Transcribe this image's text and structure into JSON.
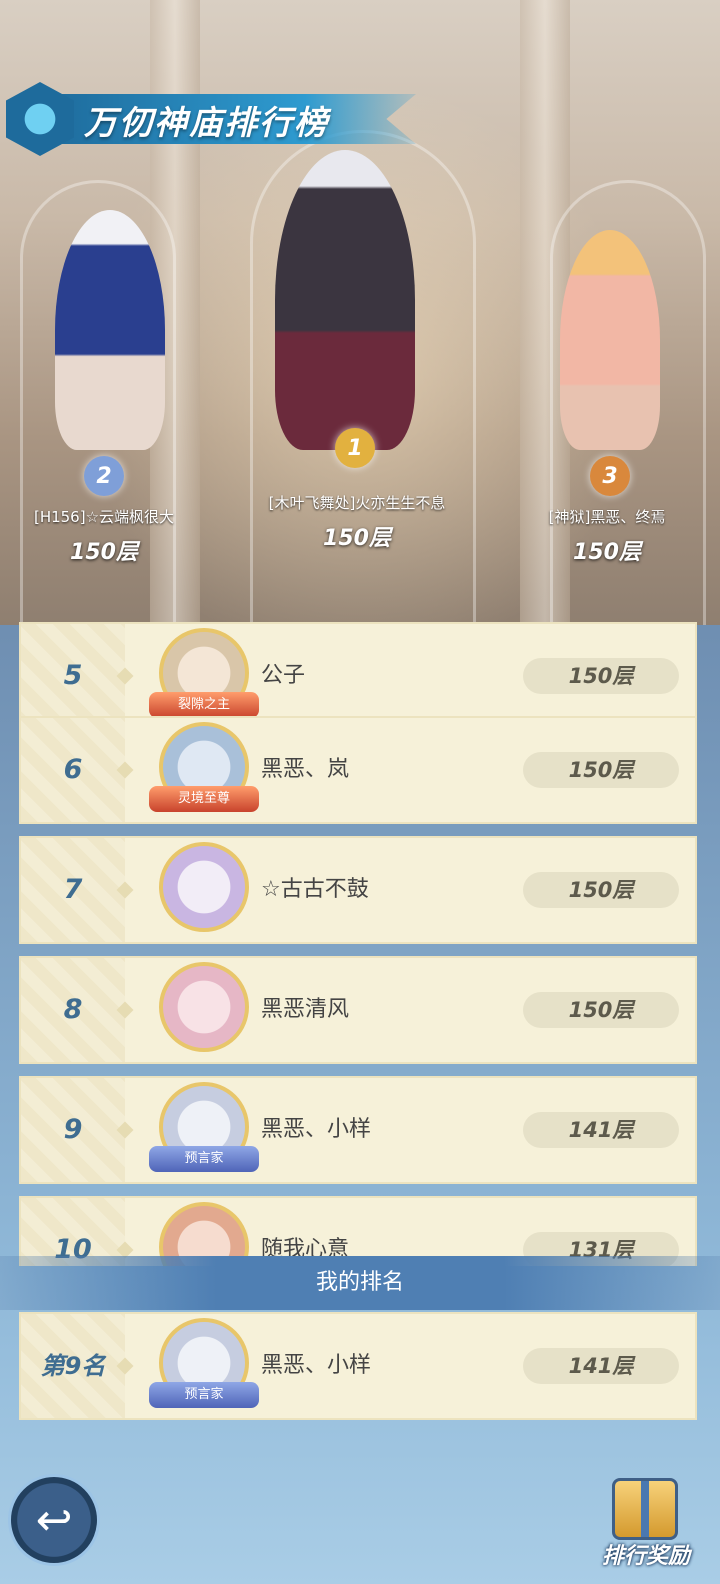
{
  "header": {
    "title": "万仞神庙排行榜"
  },
  "podium": [
    {
      "place": "1",
      "name": "[木叶飞舞处]火亦生生不息",
      "floor": "150层",
      "color": "#e2b13f"
    },
    {
      "place": "2",
      "name": "[H156]☆云端枫很大",
      "floor": "150层",
      "color": "#7f9fd8"
    },
    {
      "place": "3",
      "name": "[神狱]黑恶、终焉",
      "floor": "150层",
      "color": "#d9883c"
    }
  ],
  "rankings": [
    {
      "rank": "5",
      "name": "公子",
      "floor": "150层",
      "badge": "裂隙之主",
      "avatar_color": "#d9c6a9"
    },
    {
      "rank": "6",
      "name": "黑恶、岚",
      "floor": "150层",
      "badge": "灵境至尊",
      "avatar_color": "#a9c0d9"
    },
    {
      "rank": "7",
      "name": "☆古古不鼓",
      "floor": "150层",
      "badge": "",
      "avatar_color": "#c9b6e2"
    },
    {
      "rank": "8",
      "name": "黑恶清风",
      "floor": "150层",
      "badge": "",
      "avatar_color": "#e6b7c6"
    },
    {
      "rank": "9",
      "name": "黑恶、小样",
      "floor": "141层",
      "badge": "预言家",
      "avatar_color": "#c6cde0"
    },
    {
      "rank": "10",
      "name": "随我心意",
      "floor": "131层",
      "badge": "",
      "avatar_color": "#e2a98f"
    }
  ],
  "my_ranking": {
    "section_label": "我的排名",
    "rank": "第9名",
    "name": "黑恶、小样",
    "floor": "141层",
    "badge": "预言家"
  },
  "footer": {
    "back_icon": "back-arrow-icon",
    "reward_label": "排行奖励",
    "reward_icon": "gift-box-icon"
  }
}
